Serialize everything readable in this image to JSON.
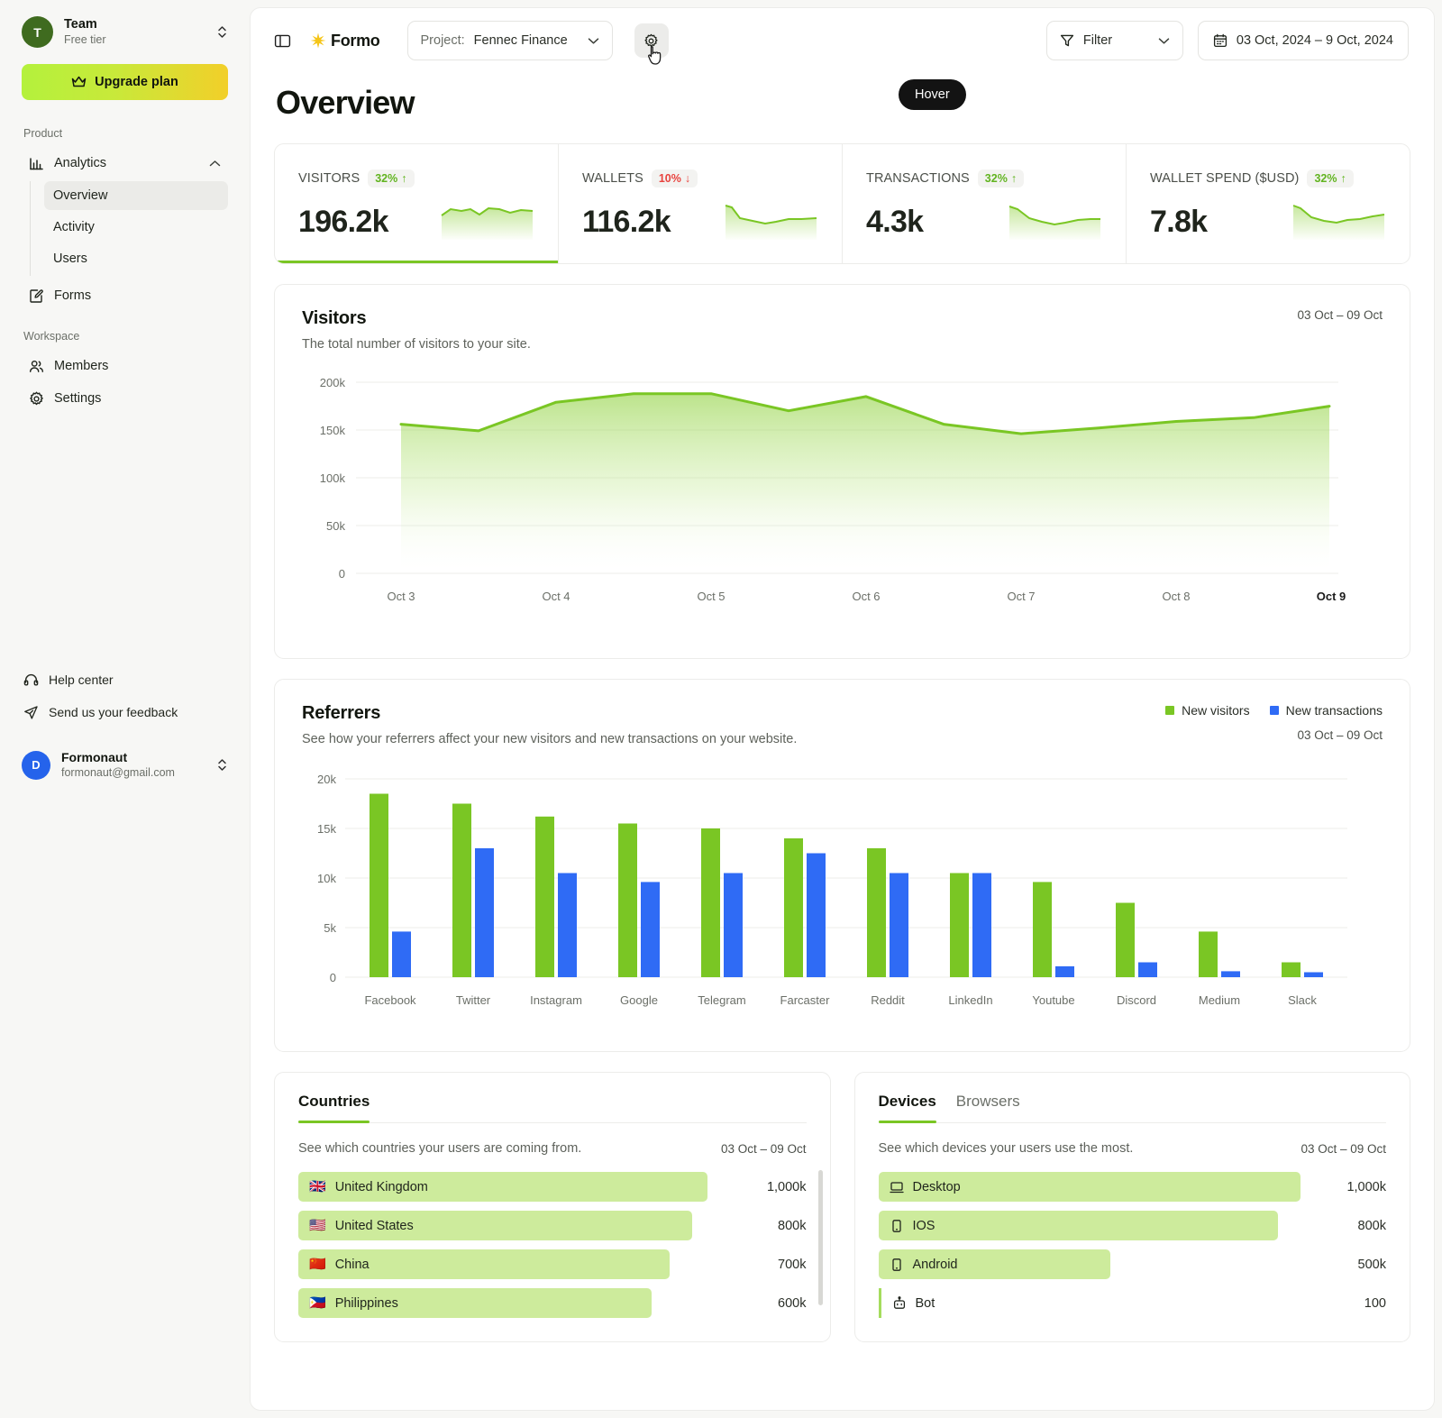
{
  "sidebar": {
    "team": {
      "initial": "T",
      "name": "Team",
      "tier": "Free tier"
    },
    "upgrade_label": "Upgrade plan",
    "product_label": "Product",
    "analytics_label": "Analytics",
    "subnav": [
      {
        "label": "Overview",
        "active": true
      },
      {
        "label": "Activity",
        "active": false
      },
      {
        "label": "Users",
        "active": false
      }
    ],
    "forms_label": "Forms",
    "workspace_label": "Workspace",
    "members_label": "Members",
    "settings_label": "Settings",
    "help_label": "Help center",
    "feedback_label": "Send us your feedback",
    "user": {
      "initial": "D",
      "name": "Formonaut",
      "email": "formonaut@gmail.com"
    }
  },
  "topbar": {
    "brand": "Formo",
    "project_prefix": "Project:",
    "project_name": "Fennec Finance",
    "tooltip": "Hover",
    "filter_label": "Filter",
    "date_range": "03 Oct, 2024 – 9 Oct, 2024"
  },
  "page": {
    "title": "Overview"
  },
  "kpis": [
    {
      "title": "VISITORS",
      "delta": "32%",
      "dir": "up",
      "value": "196.2k",
      "active": true
    },
    {
      "title": "WALLETS",
      "delta": "10%",
      "dir": "down",
      "value": "116.2k",
      "active": false
    },
    {
      "title": "TRANSACTIONS",
      "delta": "32%",
      "dir": "up",
      "value": "4.3k",
      "active": false
    },
    {
      "title": "WALLET SPEND ($USD)",
      "delta": "32%",
      "dir": "up",
      "value": "7.8k",
      "active": false
    }
  ],
  "visitors_panel": {
    "title": "Visitors",
    "subtitle": "The total number of visitors to your site.",
    "range": "03 Oct – 09 Oct"
  },
  "referrers_panel": {
    "title": "Referrers",
    "subtitle": "See how your referrers affect your new visitors and new transactions on your website.",
    "range": "03 Oct – 09 Oct",
    "legend": [
      {
        "label": "New visitors",
        "color": "#7ac624"
      },
      {
        "label": "New transactions",
        "color": "#2f6bf5"
      }
    ]
  },
  "countries_panel": {
    "title": "Countries",
    "subtitle": "See which countries your users are coming from.",
    "range": "03 Oct – 09 Oct",
    "rows": [
      {
        "flag": "🇬🇧",
        "label": "United Kingdom",
        "value": "1,000k",
        "pct": 100
      },
      {
        "flag": "🇺🇸",
        "label": "United States",
        "value": "800k",
        "pct": 80
      },
      {
        "flag": "🇨🇳",
        "label": "China",
        "value": "700k",
        "pct": 70
      },
      {
        "flag": "🇵🇭",
        "label": "Philippines",
        "value": "600k",
        "pct": 60
      }
    ]
  },
  "devices_panel": {
    "tabs": [
      {
        "label": "Devices",
        "active": true
      },
      {
        "label": "Browsers",
        "active": false
      }
    ],
    "subtitle": "See which devices your users use the most.",
    "range": "03 Oct – 09 Oct",
    "rows": [
      {
        "icon": "desktop-icon",
        "label": "Desktop",
        "value": "1,000k",
        "pct": 100
      },
      {
        "icon": "phone-icon",
        "label": "IOS",
        "value": "800k",
        "pct": 80
      },
      {
        "icon": "phone-icon",
        "label": "Android",
        "value": "500k",
        "pct": 50
      },
      {
        "icon": "bot-icon",
        "label": "Bot",
        "value": "100",
        "pct": 0
      }
    ]
  },
  "chart_data": [
    {
      "type": "area",
      "title": "Visitors",
      "xlabel": "",
      "ylabel": "",
      "ylim": [
        0,
        200000
      ],
      "ytick_labels": [
        "200k",
        "150k",
        "100k",
        "50k",
        "0"
      ],
      "ytick_values": [
        200000,
        150000,
        100000,
        50000,
        0
      ],
      "xtick_labels": [
        "Oct 3",
        "Oct 4",
        "Oct 5",
        "Oct 6",
        "Oct 7",
        "Oct 8",
        "Oct 9"
      ],
      "grid": true,
      "legend_position": "none",
      "line_color": "#7ac624",
      "x": [
        0,
        0.5,
        1,
        1.5,
        2,
        2.5,
        3,
        3.5,
        4,
        4.5,
        5,
        5.5,
        6
      ],
      "values": [
        156000,
        149000,
        179000,
        188000,
        188000,
        170000,
        186000,
        157000,
        146000,
        152000,
        159000,
        163000,
        175000
      ]
    },
    {
      "type": "bar",
      "title": "Referrers",
      "xlabel": "",
      "ylabel": "",
      "ylim": [
        0,
        20000
      ],
      "ytick_labels": [
        "20k",
        "15k",
        "10k",
        "5k",
        "0"
      ],
      "ytick_values": [
        20000,
        15000,
        10000,
        5000,
        0
      ],
      "grid": true,
      "legend_position": "top-right",
      "categories": [
        "Facebook",
        "Twitter",
        "Instagram",
        "Google",
        "Telegram",
        "Farcaster",
        "Reddit",
        "LinkedIn",
        "Youtube",
        "Discord",
        "Medium",
        "Slack"
      ],
      "series": [
        {
          "name": "New visitors",
          "color": "#7ac624",
          "values": [
            18500,
            17500,
            16200,
            15500,
            15000,
            14000,
            13000,
            10500,
            9600,
            7500,
            4600,
            1500
          ]
        },
        {
          "name": "New transactions",
          "color": "#2f6bf5",
          "values": [
            4600,
            13000,
            10500,
            9600,
            10500,
            12500,
            10500,
            10500,
            1100,
            1500,
            600,
            500
          ]
        }
      ]
    },
    {
      "type": "bar",
      "title": "Countries",
      "categories": [
        "United Kingdom",
        "United States",
        "China",
        "Philippines"
      ],
      "values": [
        1000000,
        800000,
        700000,
        600000
      ],
      "value_labels": [
        "1,000k",
        "800k",
        "700k",
        "600k"
      ],
      "ylim": [
        0,
        1000000
      ],
      "grid": false,
      "legend_position": "none"
    },
    {
      "type": "bar",
      "title": "Devices",
      "categories": [
        "Desktop",
        "IOS",
        "Android",
        "Bot"
      ],
      "values": [
        1000000,
        800000,
        500000,
        100
      ],
      "value_labels": [
        "1,000k",
        "800k",
        "500k",
        "100"
      ],
      "ylim": [
        0,
        1000000
      ],
      "grid": false,
      "legend_position": "none"
    }
  ]
}
